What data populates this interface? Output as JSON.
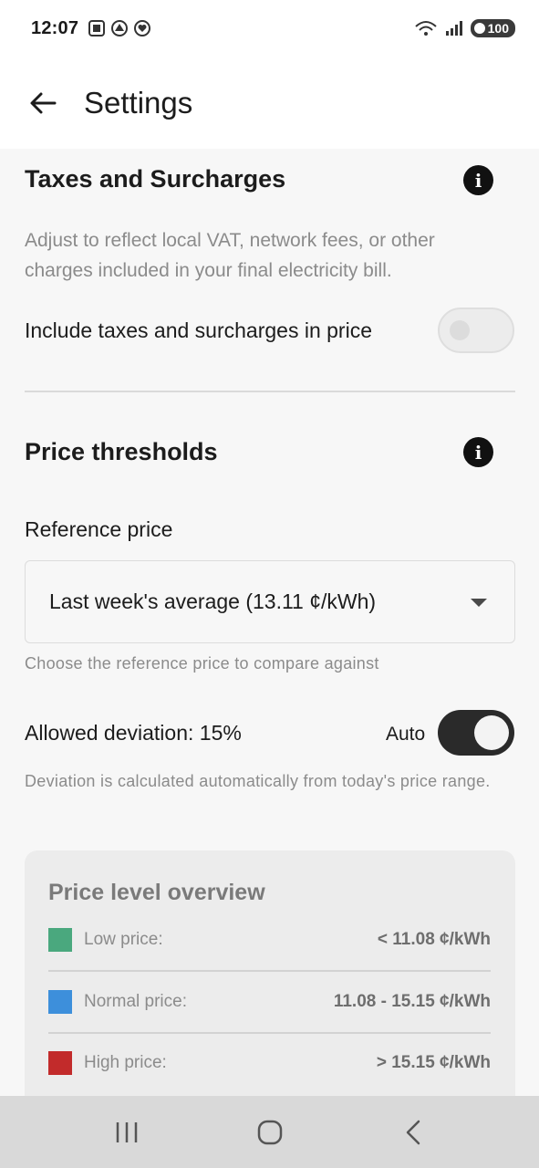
{
  "status": {
    "time": "12:07",
    "battery": "100"
  },
  "app_bar": {
    "title": "Settings"
  },
  "taxes": {
    "title": "Taxes and Surcharges",
    "description": "Adjust to reflect local VAT, network fees, or other charges included in your final electricity bill.",
    "toggle_label": "Include taxes and surcharges in price",
    "toggle_on": false
  },
  "thresholds": {
    "title": "Price thresholds",
    "reference_label": "Reference price",
    "reference_value": "Last week's average (13.11 ¢/kWh)",
    "reference_helper": "Choose the reference price to compare against",
    "deviation_label": "Allowed deviation: 15%",
    "auto_label": "Auto",
    "auto_on": true,
    "deviation_helper": "Deviation is calculated automatically from today's price range."
  },
  "overview": {
    "title": "Price level overview",
    "rows": [
      {
        "label": "Low price:",
        "value": "< 11.08 ¢/kWh",
        "color": "#4aa87e"
      },
      {
        "label": "Normal price:",
        "value": "11.08 - 15.15 ¢/kWh",
        "color": "#3d8fdb"
      },
      {
        "label": "High price:",
        "value": "> 15.15 ¢/kWh",
        "color": "#c22b2b"
      }
    ]
  },
  "icons": {
    "back": "arrow-left-icon",
    "info": "info-icon",
    "nav_recents": "recents-icon",
    "nav_home": "home-icon",
    "nav_back": "chevron-left-icon"
  }
}
